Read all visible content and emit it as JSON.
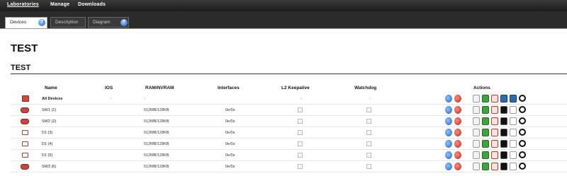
{
  "topnav": {
    "items": [
      {
        "label": "Laboratories",
        "active": true
      },
      {
        "label": "Manage"
      },
      {
        "label": "Downloads"
      }
    ]
  },
  "tabs": [
    {
      "label": "Devices",
      "active": true
    },
    {
      "label": "Description"
    },
    {
      "label": "Diagram"
    }
  ],
  "lab": {
    "title": "TEST",
    "subtitle": "TEST"
  },
  "table": {
    "headers": {
      "name": "Name",
      "ios": "IOS",
      "ram": "RAM/NVRAM",
      "interfaces": "Interfaces",
      "l2": "L2 Keepalive",
      "watchdog": "Watchdog",
      "actions": "Actions"
    },
    "rows": [
      {
        "icon": "all-devices-icon",
        "name": "All Devices",
        "ios": "-",
        "ram": "-",
        "interfaces": "",
        "l2": "-",
        "watchdog": "-",
        "bold": true
      },
      {
        "icon": "router-icon",
        "name": "SW1 (1)",
        "ios": "",
        "ram": "512MB/128KB",
        "interfaces": "0e/0s",
        "l2": "",
        "watchdog": ""
      },
      {
        "icon": "router-icon",
        "name": "SW2 (2)",
        "ios": "",
        "ram": "512MB/128KB",
        "interfaces": "0e/0s",
        "l2": "",
        "watchdog": ""
      },
      {
        "icon": "pc-icon",
        "name": "D1 (3)",
        "ios": "",
        "ram": "512MB/128KB",
        "interfaces": "0e/0s",
        "l2": "",
        "watchdog": ""
      },
      {
        "icon": "pc-icon",
        "name": "D1 (4)",
        "ios": "",
        "ram": "512MB/128KB",
        "interfaces": "0e/0s",
        "l2": "",
        "watchdog": ""
      },
      {
        "icon": "pc-icon",
        "name": "D1 (5)",
        "ios": "",
        "ram": "512MB/128KB",
        "interfaces": "0e/0s",
        "l2": "",
        "watchdog": ""
      },
      {
        "icon": "router-icon",
        "name": "SW3 (6)",
        "ios": "",
        "ram": "512MB/128KB",
        "interfaces": "0e/0s",
        "l2": "",
        "watchdog": ""
      }
    ]
  },
  "tab_help_glyph": "?",
  "colors": {
    "topbar": "#2b2b2b",
    "accent_blue": "#1e6ad6",
    "accent_red": "#c0392b"
  }
}
